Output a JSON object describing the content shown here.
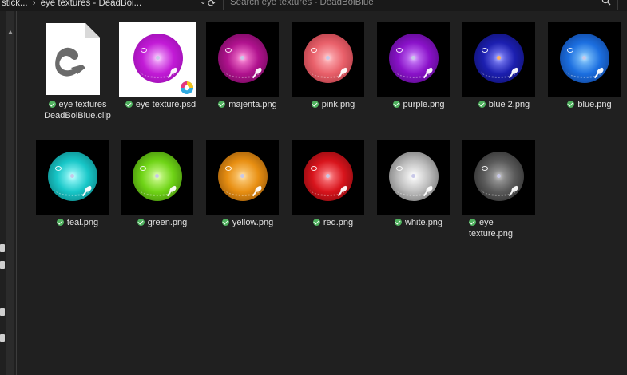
{
  "address_bar": {
    "crumbs": [
      "stick...",
      "eye textures - DeadBoi..."
    ],
    "separator": "›"
  },
  "search": {
    "placeholder": "Search eye textures - DeadBoiBlue"
  },
  "files": [
    {
      "name": "eye textures DeadBoiBlue.clip",
      "type": "clip",
      "status": "synced"
    },
    {
      "name": "eye texture.psd",
      "type": "psd",
      "status": "synced",
      "color": "#c21bd6"
    },
    {
      "name": "majenta.png",
      "type": "png",
      "status": "synced",
      "color": "#b0128e"
    },
    {
      "name": "pink.png",
      "type": "png",
      "status": "synced",
      "color": "#e9606a"
    },
    {
      "name": "purple.png",
      "type": "png",
      "status": "synced",
      "color": "#8a12c9"
    },
    {
      "name": "blue 2.png",
      "type": "png",
      "status": "synced",
      "color": "#1c1fb0"
    },
    {
      "name": "blue.png",
      "type": "png",
      "status": "synced",
      "color": "#1c6fe0"
    },
    {
      "name": "teal.png",
      "type": "png",
      "status": "synced",
      "color": "#18c7c8"
    },
    {
      "name": "green.png",
      "type": "png",
      "status": "synced",
      "color": "#6fd416"
    },
    {
      "name": "yellow.png",
      "type": "png",
      "status": "synced",
      "color": "#e88f12"
    },
    {
      "name": "red.png",
      "type": "png",
      "status": "synced",
      "color": "#d8141c"
    },
    {
      "name": "white.png",
      "type": "png",
      "status": "synced",
      "color": "#bdbdbd"
    },
    {
      "name": "eye texture.png",
      "type": "png",
      "status": "synced",
      "color": "#5a5a5a"
    }
  ]
}
